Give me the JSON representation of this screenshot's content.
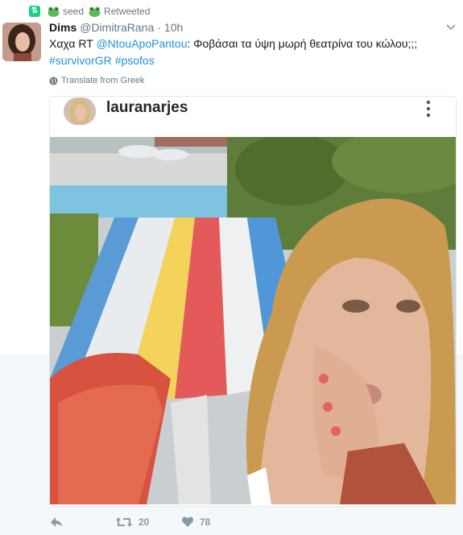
{
  "context": {
    "label_a": "seed",
    "label_b": "Retweeted",
    "icon": "retweet-badge-icon"
  },
  "tweet": {
    "fullname": "Dims",
    "username": "@DimitraRana",
    "separator": "·",
    "time": "10h",
    "text_prefix": "Χαχα RT ",
    "mention": "@NtouApoPantou",
    "text_body": ": Φοβάσαι τα ύψη μωρή θεατρίνα του κώλου;;;",
    "hashtag_1": "#survivorGR",
    "hashtag_2": "#psofos",
    "translate": "Translate from Greek"
  },
  "card": {
    "username": "lauranarjes"
  },
  "actions": {
    "retweets": "20",
    "likes": "78"
  },
  "colors": {
    "link": "#1b95e0",
    "retweet_green": "#19cf86",
    "icon_gray": "#8899a6"
  }
}
